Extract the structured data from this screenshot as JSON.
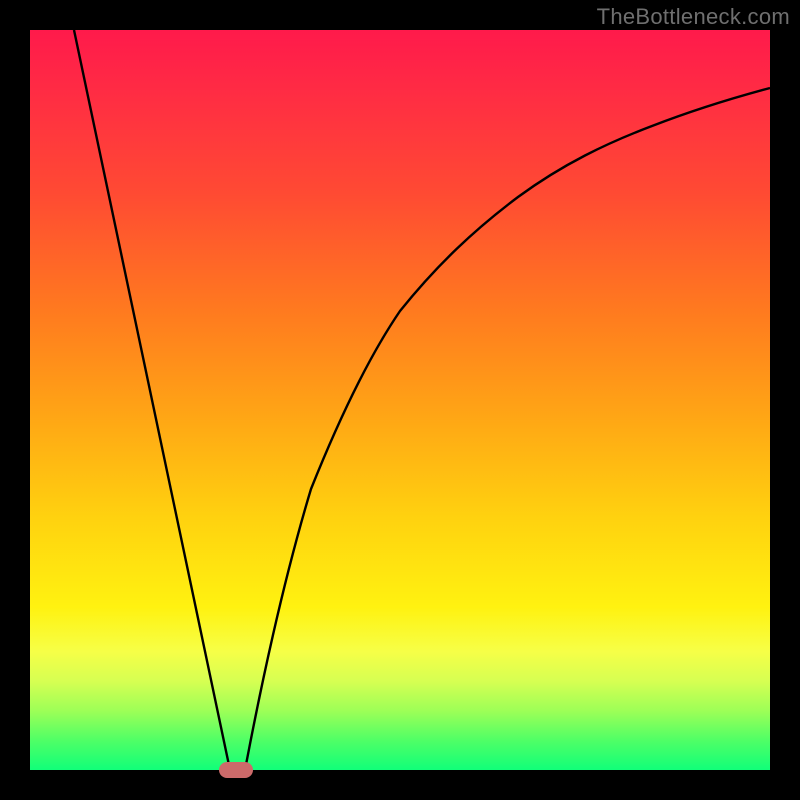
{
  "watermark": "TheBottleneck.com",
  "chart_data": {
    "type": "line",
    "title": "",
    "xlabel": "",
    "ylabel": "",
    "xlim": [
      0,
      100
    ],
    "ylim": [
      0,
      100
    ],
    "grid": false,
    "legend": false,
    "background_gradient_stops": [
      {
        "pct": 0,
        "color": "#ff1a4b"
      },
      {
        "pct": 8,
        "color": "#ff2b44"
      },
      {
        "pct": 22,
        "color": "#ff4a33"
      },
      {
        "pct": 38,
        "color": "#ff7a1f"
      },
      {
        "pct": 52,
        "color": "#ffa515"
      },
      {
        "pct": 66,
        "color": "#ffd20f"
      },
      {
        "pct": 78,
        "color": "#fff210"
      },
      {
        "pct": 84,
        "color": "#f6ff47"
      },
      {
        "pct": 88,
        "color": "#d6ff52"
      },
      {
        "pct": 92,
        "color": "#9dff57"
      },
      {
        "pct": 96,
        "color": "#4fff66"
      },
      {
        "pct": 100,
        "color": "#11ff79"
      }
    ],
    "series": [
      {
        "name": "left-line",
        "x": [
          6,
          27
        ],
        "y": [
          100,
          0
        ],
        "style": "straight"
      },
      {
        "name": "right-curve",
        "x": [
          29,
          32,
          35,
          38,
          42,
          46,
          50,
          55,
          60,
          66,
          72,
          78,
          84,
          90,
          96,
          100
        ],
        "y": [
          0,
          15,
          28,
          38,
          48,
          56,
          62,
          68,
          73,
          78,
          82,
          85,
          88,
          90,
          92,
          93
        ],
        "style": "smooth"
      }
    ],
    "marker": {
      "shape": "rounded-lozenge",
      "x": 27.8,
      "y": 0,
      "color": "#cc6a6a"
    }
  }
}
